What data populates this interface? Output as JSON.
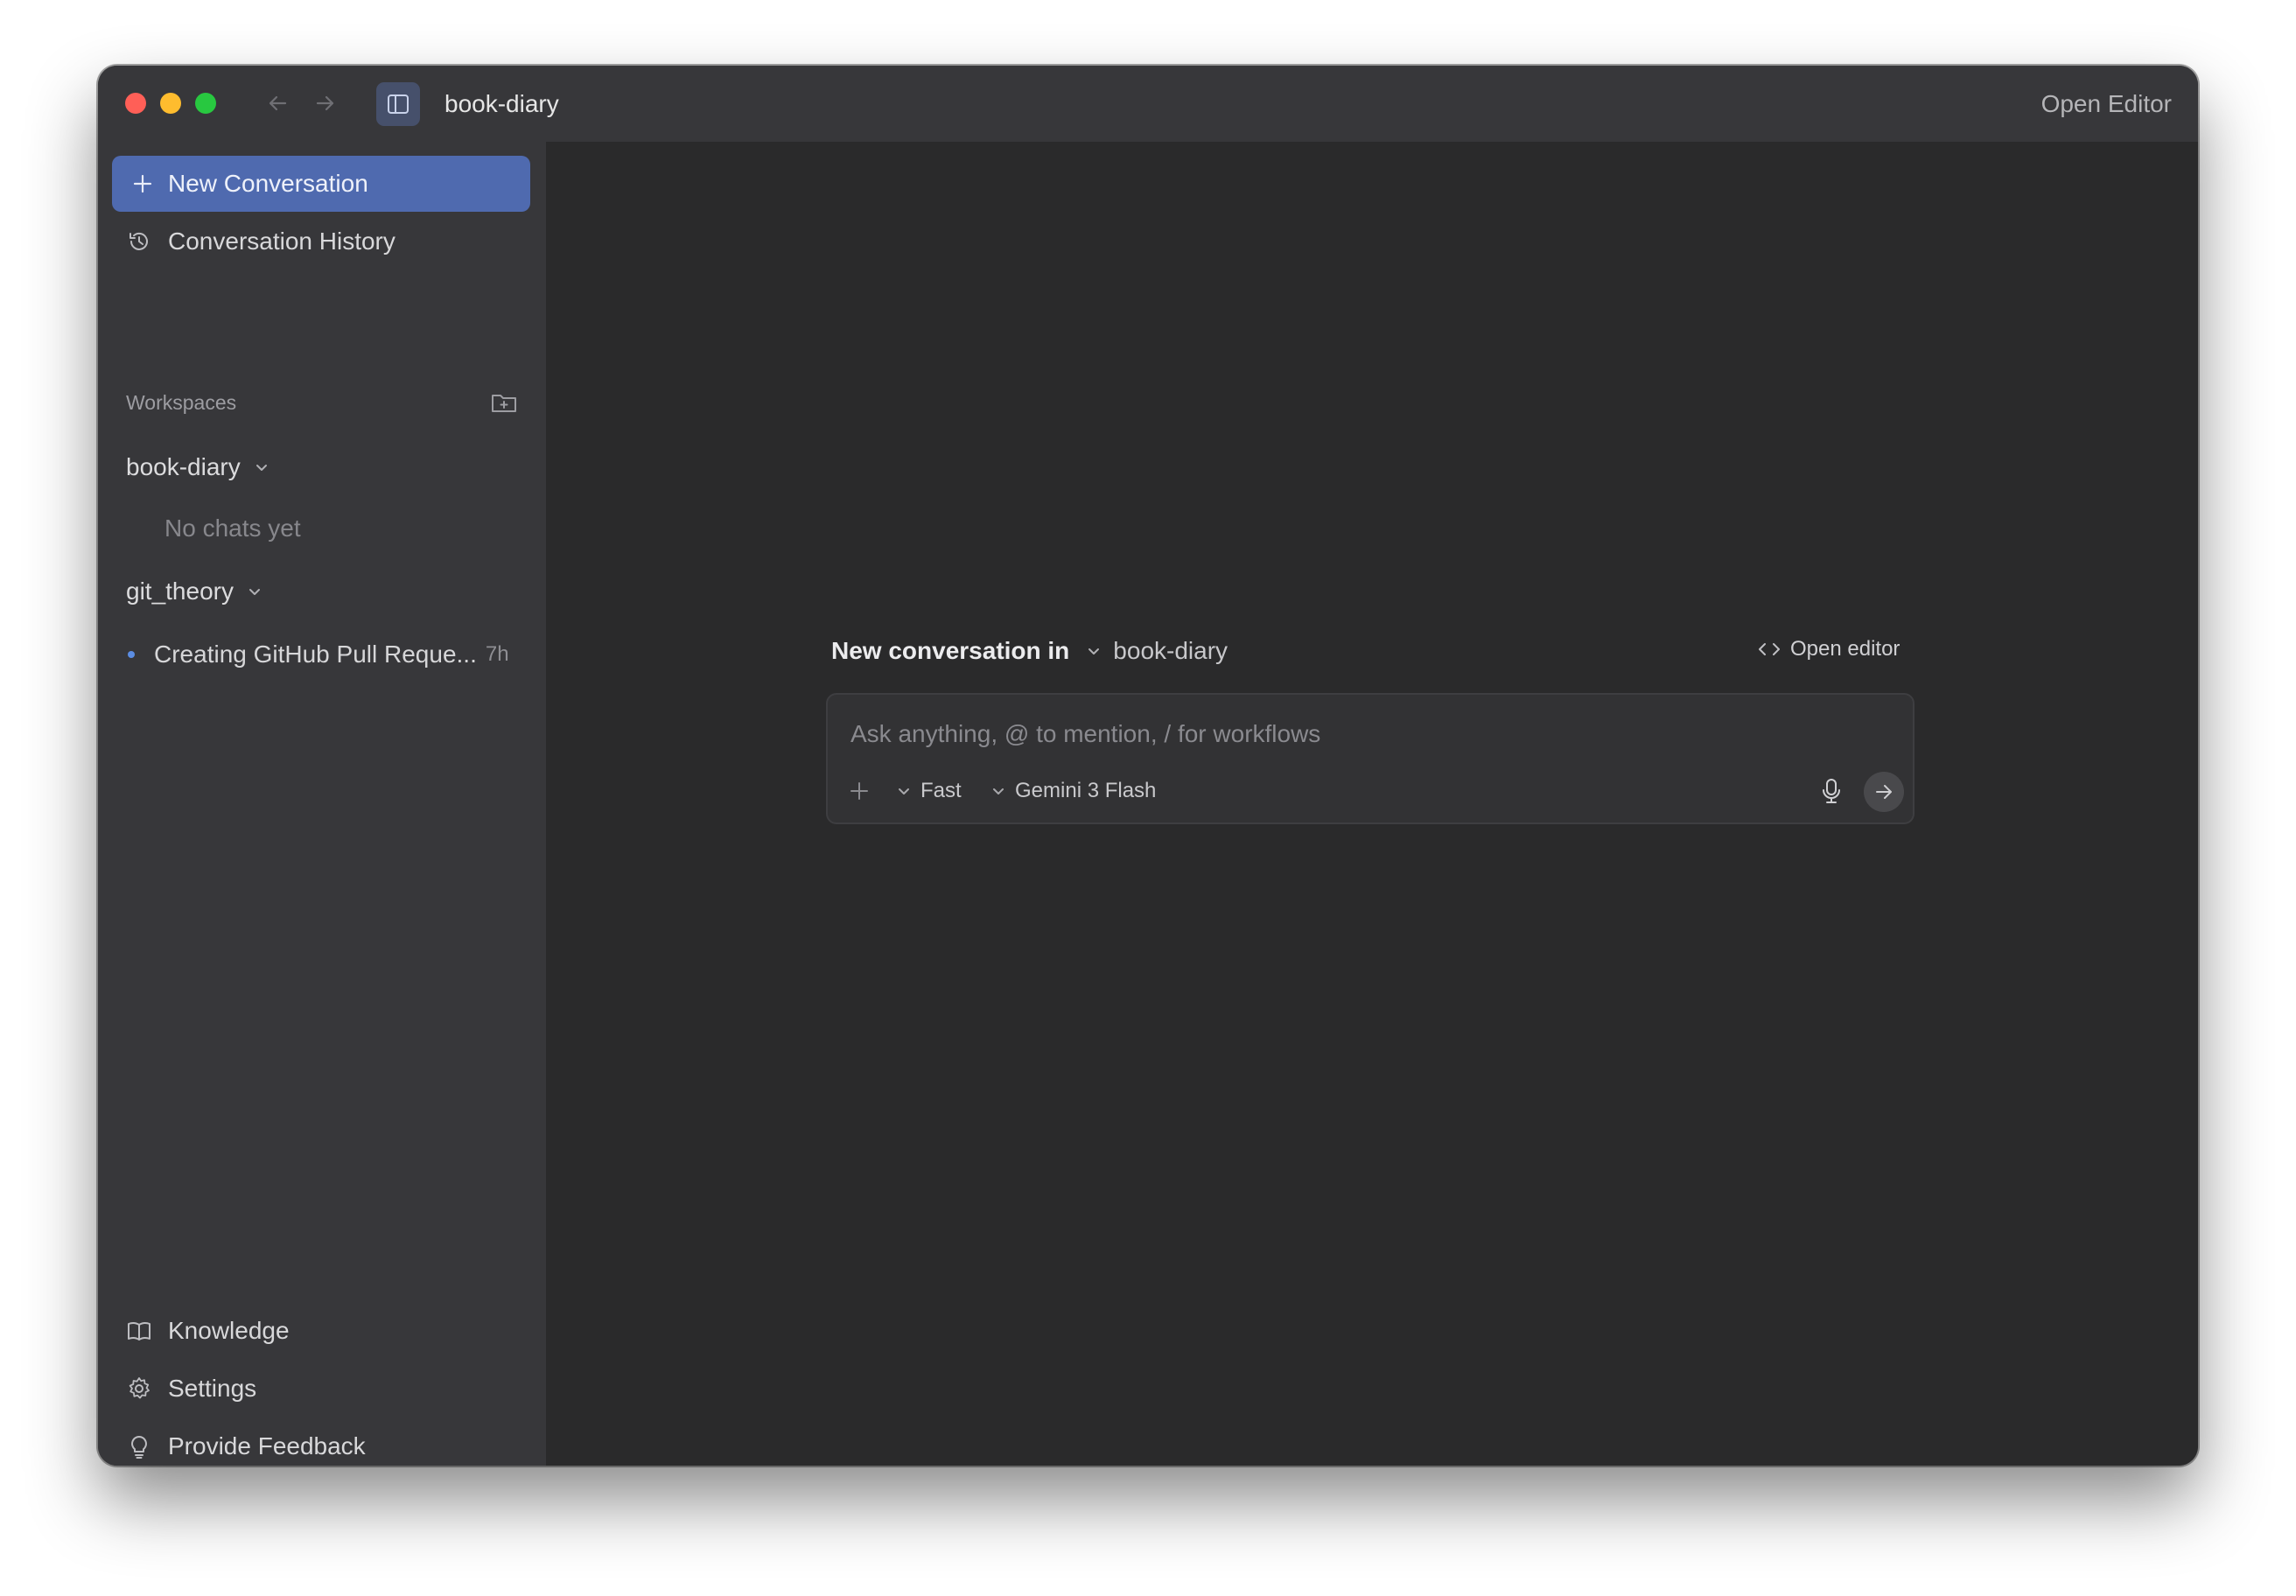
{
  "window": {
    "title": "book-diary",
    "open_editor_label": "Open Editor"
  },
  "sidebar": {
    "new_conversation_label": "New Conversation",
    "conversation_history_label": "Conversation History",
    "workspaces_label": "Workspaces",
    "workspaces": [
      {
        "name": "book-diary",
        "empty_text": "No chats yet",
        "chats": []
      },
      {
        "name": "git_theory",
        "chats": [
          {
            "title": "Creating GitHub Pull Reque...",
            "time": "7h"
          }
        ]
      }
    ],
    "footer": {
      "knowledge_label": "Knowledge",
      "settings_label": "Settings",
      "feedback_label": "Provide Feedback"
    }
  },
  "main": {
    "header_lead": "New conversation in",
    "header_workspace": "book-diary",
    "open_editor_label": "Open editor",
    "composer": {
      "placeholder": "Ask anything, @ to mention, / for workflows",
      "value": "",
      "mode": "Fast",
      "model": "Gemini 3 Flash"
    }
  },
  "colors": {
    "accent": "#4f6aaf",
    "sidebar_bg": "#37373a",
    "main_bg": "#2a2a2b",
    "close": "#ff5f57",
    "minimize": "#febc2e",
    "zoom": "#28c840",
    "chat_dot": "#5b8de3"
  },
  "icons": {
    "back": "arrow-left-icon",
    "forward": "arrow-right-icon",
    "sidebar_toggle": "sidebar-panel-icon",
    "new": "plus-icon",
    "history": "history-icon",
    "add_workspace": "folder-plus-icon",
    "knowledge": "book-icon",
    "settings": "gear-icon",
    "feedback": "lightbulb-icon",
    "code": "code-icon",
    "mic": "microphone-icon",
    "send": "arrow-right-icon"
  }
}
